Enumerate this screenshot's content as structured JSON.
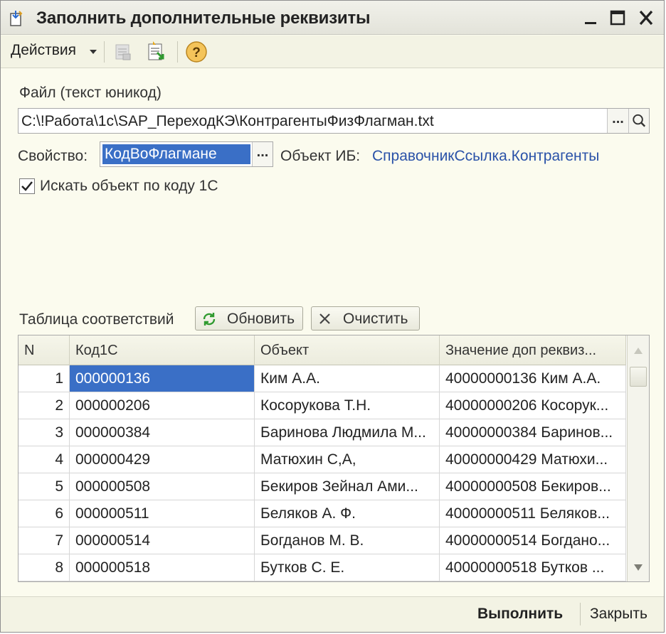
{
  "window": {
    "title": "Заполнить дополнительные реквизиты",
    "icon": "form-fill-icon",
    "controls": [
      "minimize-icon",
      "maximize-icon",
      "close-icon"
    ]
  },
  "toolbar": {
    "actions_label": "Действия",
    "icons": [
      "report-disabled-icon",
      "load-document-icon",
      "help-icon"
    ],
    "help_symbol": "?"
  },
  "file": {
    "label": "Файл (текст юникод)",
    "value": "C:\\!Работа\\1с\\SAP_ПереходКЭ\\КонтрагентыФизФлагман.txt",
    "select_button": "...",
    "search_icon": "search-icon"
  },
  "property": {
    "label": "Свойство:",
    "value": "КодВоФлагмане",
    "select_button": "..."
  },
  "object_ib": {
    "label": "Объект ИБ:",
    "link": "СправочникСсылка.Контрагенты"
  },
  "search_by_code": {
    "label": "Искать объект по коду 1С",
    "checked": true
  },
  "mapping": {
    "label": "Таблица соответствий",
    "refresh_label": "Обновить",
    "clear_label": "Очистить"
  },
  "table": {
    "columns": [
      "N",
      "Код1С",
      "Объект",
      "Значение доп реквиз..."
    ],
    "rows": [
      {
        "n": "1",
        "code": "000000136",
        "object": "Ким А.А.",
        "value": "40000000136 Ким А.А."
      },
      {
        "n": "2",
        "code": "000000206",
        "object": "Косорукова Т.Н.",
        "value": "40000000206 Косорук..."
      },
      {
        "n": "3",
        "code": "000000384",
        "object": "Баринова Людмила М...",
        "value": "40000000384 Баринов..."
      },
      {
        "n": "4",
        "code": "000000429",
        "object": "Матюхин С,А,",
        "value": "40000000429 Матюхи..."
      },
      {
        "n": "5",
        "code": "000000508",
        "object": "Бекиров Зейнал Ами...",
        "value": "40000000508 Бекиров..."
      },
      {
        "n": "6",
        "code": "000000511",
        "object": "Беляков А. Ф.",
        "value": "40000000511 Беляков..."
      },
      {
        "n": "7",
        "code": "000000514",
        "object": "Богданов М. В.",
        "value": "40000000514 Богдано..."
      },
      {
        "n": "8",
        "code": "000000518",
        "object": "Бутков С. Е.",
        "value": "40000000518 Бутков ..."
      }
    ],
    "selected_row": 0
  },
  "footer": {
    "execute_label": "Выполнить",
    "close_label": "Закрыть"
  },
  "colors": {
    "selection": "#3a6fc6",
    "link": "#2a52a8",
    "window_bg": "#fbfbee",
    "toolbar_bg": "#f3f3e4"
  }
}
